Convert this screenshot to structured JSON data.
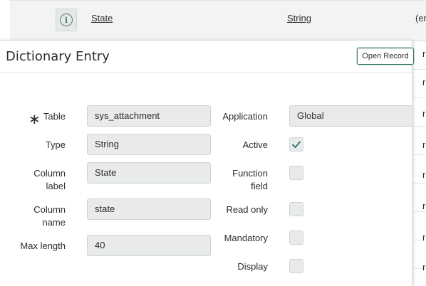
{
  "list": {
    "row": {
      "info_icon": "info-icon",
      "name_link": "State",
      "type_link": "String",
      "truncated": "(er"
    },
    "truncated_rows": [
      "r",
      "r",
      "r",
      "r",
      "r",
      "r",
      "r",
      "r"
    ]
  },
  "popover": {
    "title": "Dictionary Entry",
    "open_record_label": "Open Record",
    "fields": {
      "table_label": "Table",
      "table_value": "sys_attachment",
      "type_label": "Type",
      "type_value": "String",
      "column_label_label_l1": "Column",
      "column_label_label_l2": "label",
      "column_label_value": "State",
      "column_name_label_l1": "Column",
      "column_name_label_l2": "name",
      "column_name_value": "state",
      "max_length_label": "Max length",
      "max_length_value": "40",
      "application_label": "Application",
      "application_value": "Global",
      "active_label": "Active",
      "active_checked": true,
      "function_field_label_l1": "Function",
      "function_field_label_l2": "field",
      "function_field_checked": false,
      "read_only_label": "Read only",
      "read_only_checked": false,
      "mandatory_label": "Mandatory",
      "mandatory_checked": false,
      "display_label": "Display",
      "display_checked": false
    },
    "required_marker": "∗"
  },
  "colors": {
    "accent": "#2f6f63",
    "check": "#3d7a6e",
    "field_bg": "#e8eaeb"
  }
}
